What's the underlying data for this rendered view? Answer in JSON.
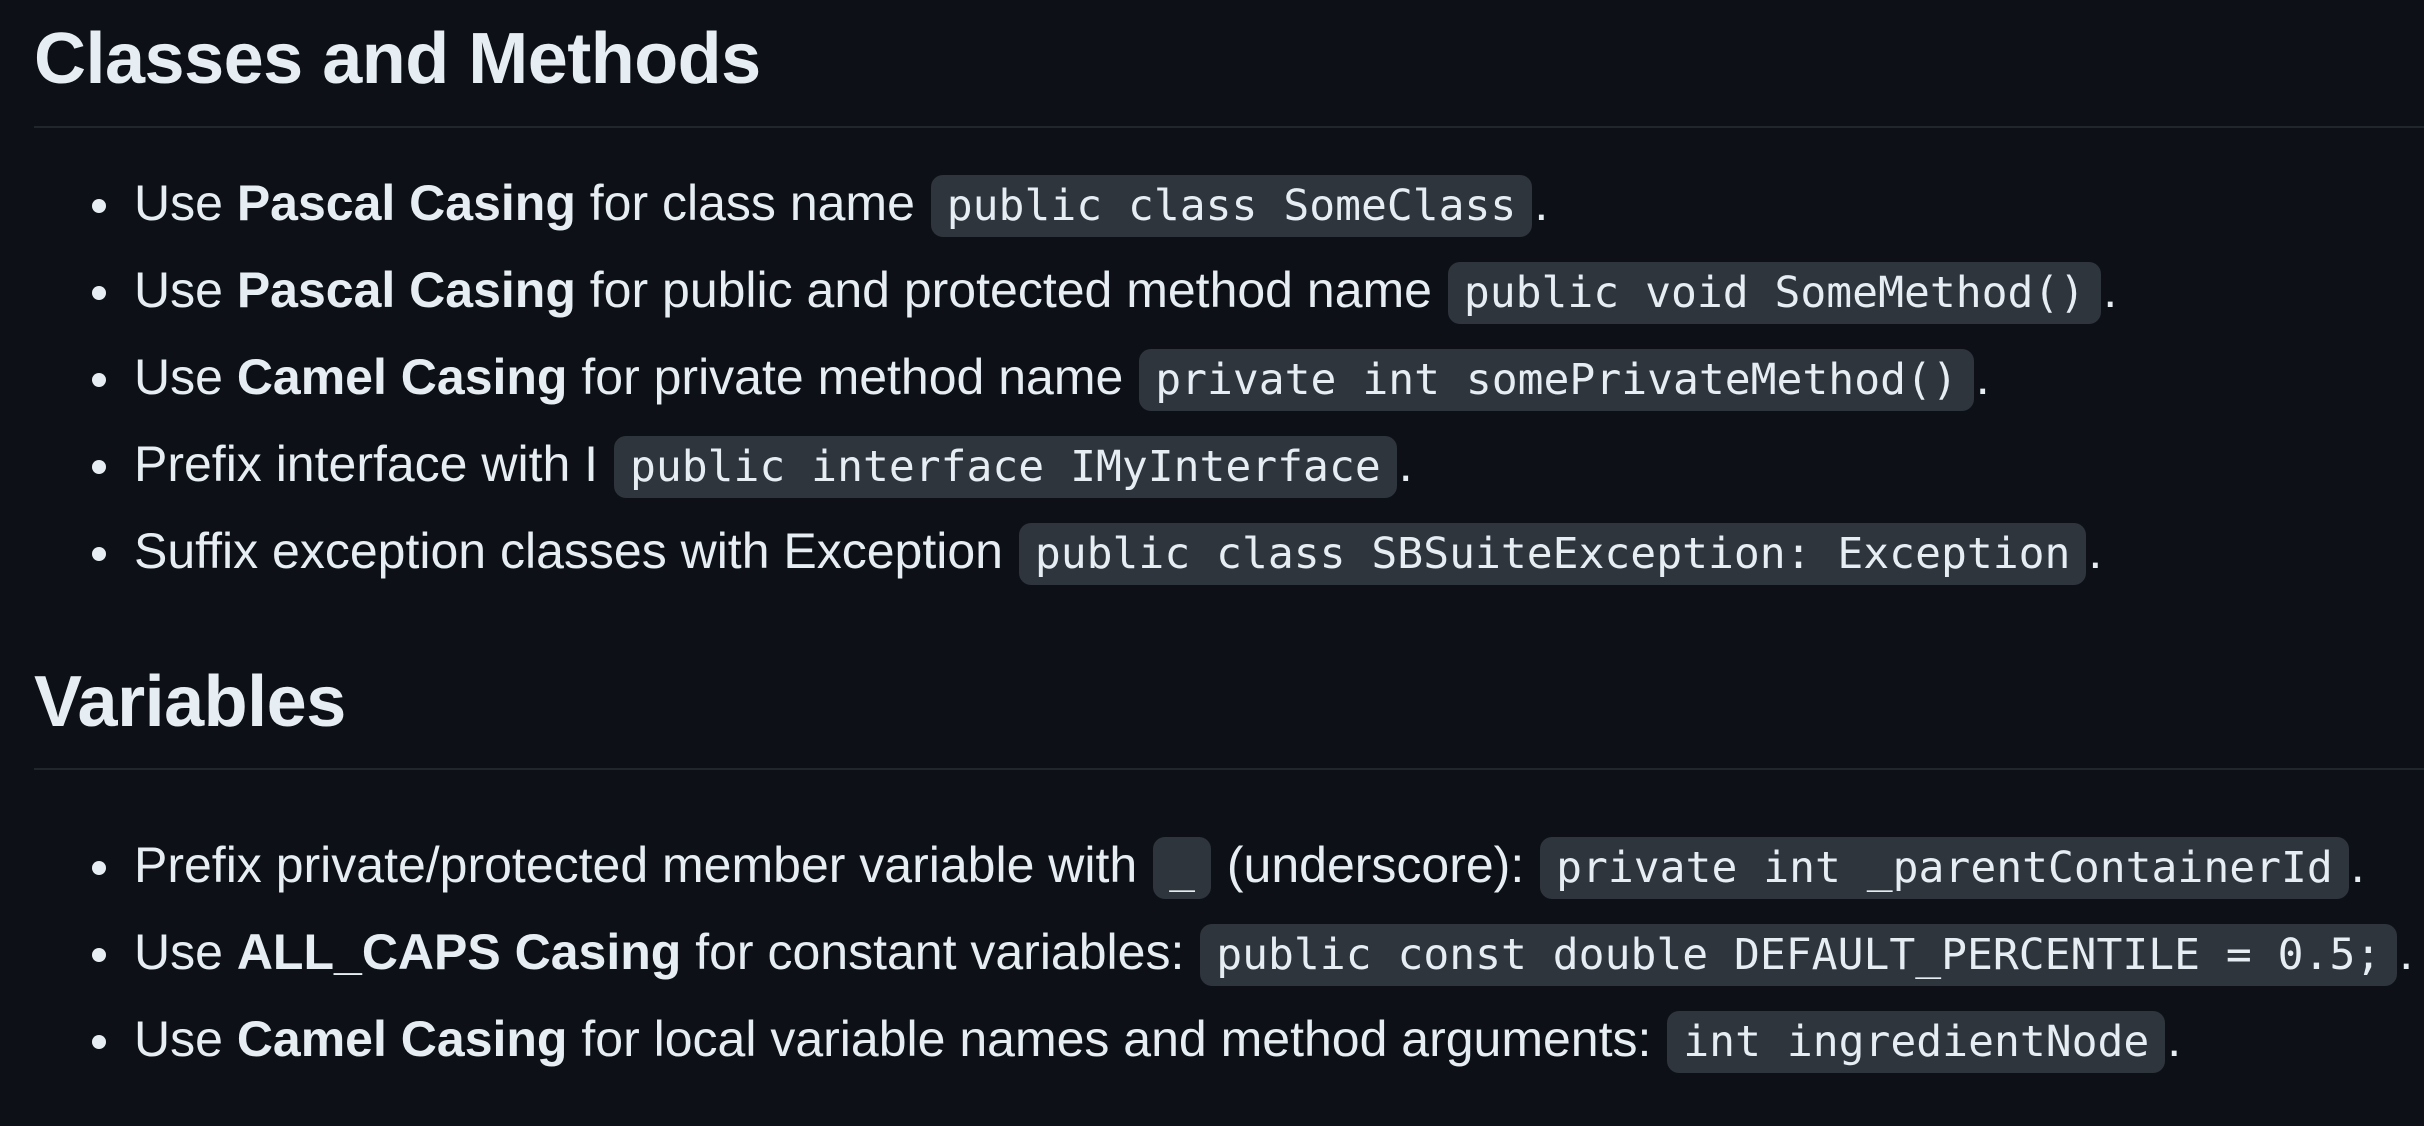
{
  "classes_section": {
    "heading": "Classes and Methods",
    "items": [
      {
        "pre": "Use ",
        "bold": "Pascal Casing",
        "mid": " for class name ",
        "code": "public class SomeClass",
        "post": "."
      },
      {
        "pre": "Use ",
        "bold": "Pascal Casing",
        "mid": " for public and protected method name ",
        "code": "public void SomeMethod()",
        "post": "."
      },
      {
        "pre": "Use ",
        "bold": "Camel Casing",
        "mid": " for private method name ",
        "code": "private int somePrivateMethod()",
        "post": "."
      },
      {
        "text": "Prefix interface with I ",
        "code": "public interface IMyInterface",
        "post": "."
      },
      {
        "text": "Suffix exception classes with Exception ",
        "code": "public class SBSuiteException: Exception",
        "post": "."
      }
    ]
  },
  "variables_section": {
    "heading": "Variables",
    "items": [
      {
        "text": "Prefix private/protected member variable with ",
        "code1": "_",
        "mid": " (underscore): ",
        "code2": "private int _parentContainerId",
        "post": "."
      },
      {
        "pre": "Use ",
        "bold": "ALL_CAPS Casing",
        "mid": " for constant variables: ",
        "code": "public const double DEFAULT_PERCENTILE = 0.5;",
        "post": "."
      },
      {
        "pre": "Use ",
        "bold": "Camel Casing",
        "mid": " for local variable names and method arguments: ",
        "code": "int ingredientNode",
        "post": "."
      }
    ]
  }
}
